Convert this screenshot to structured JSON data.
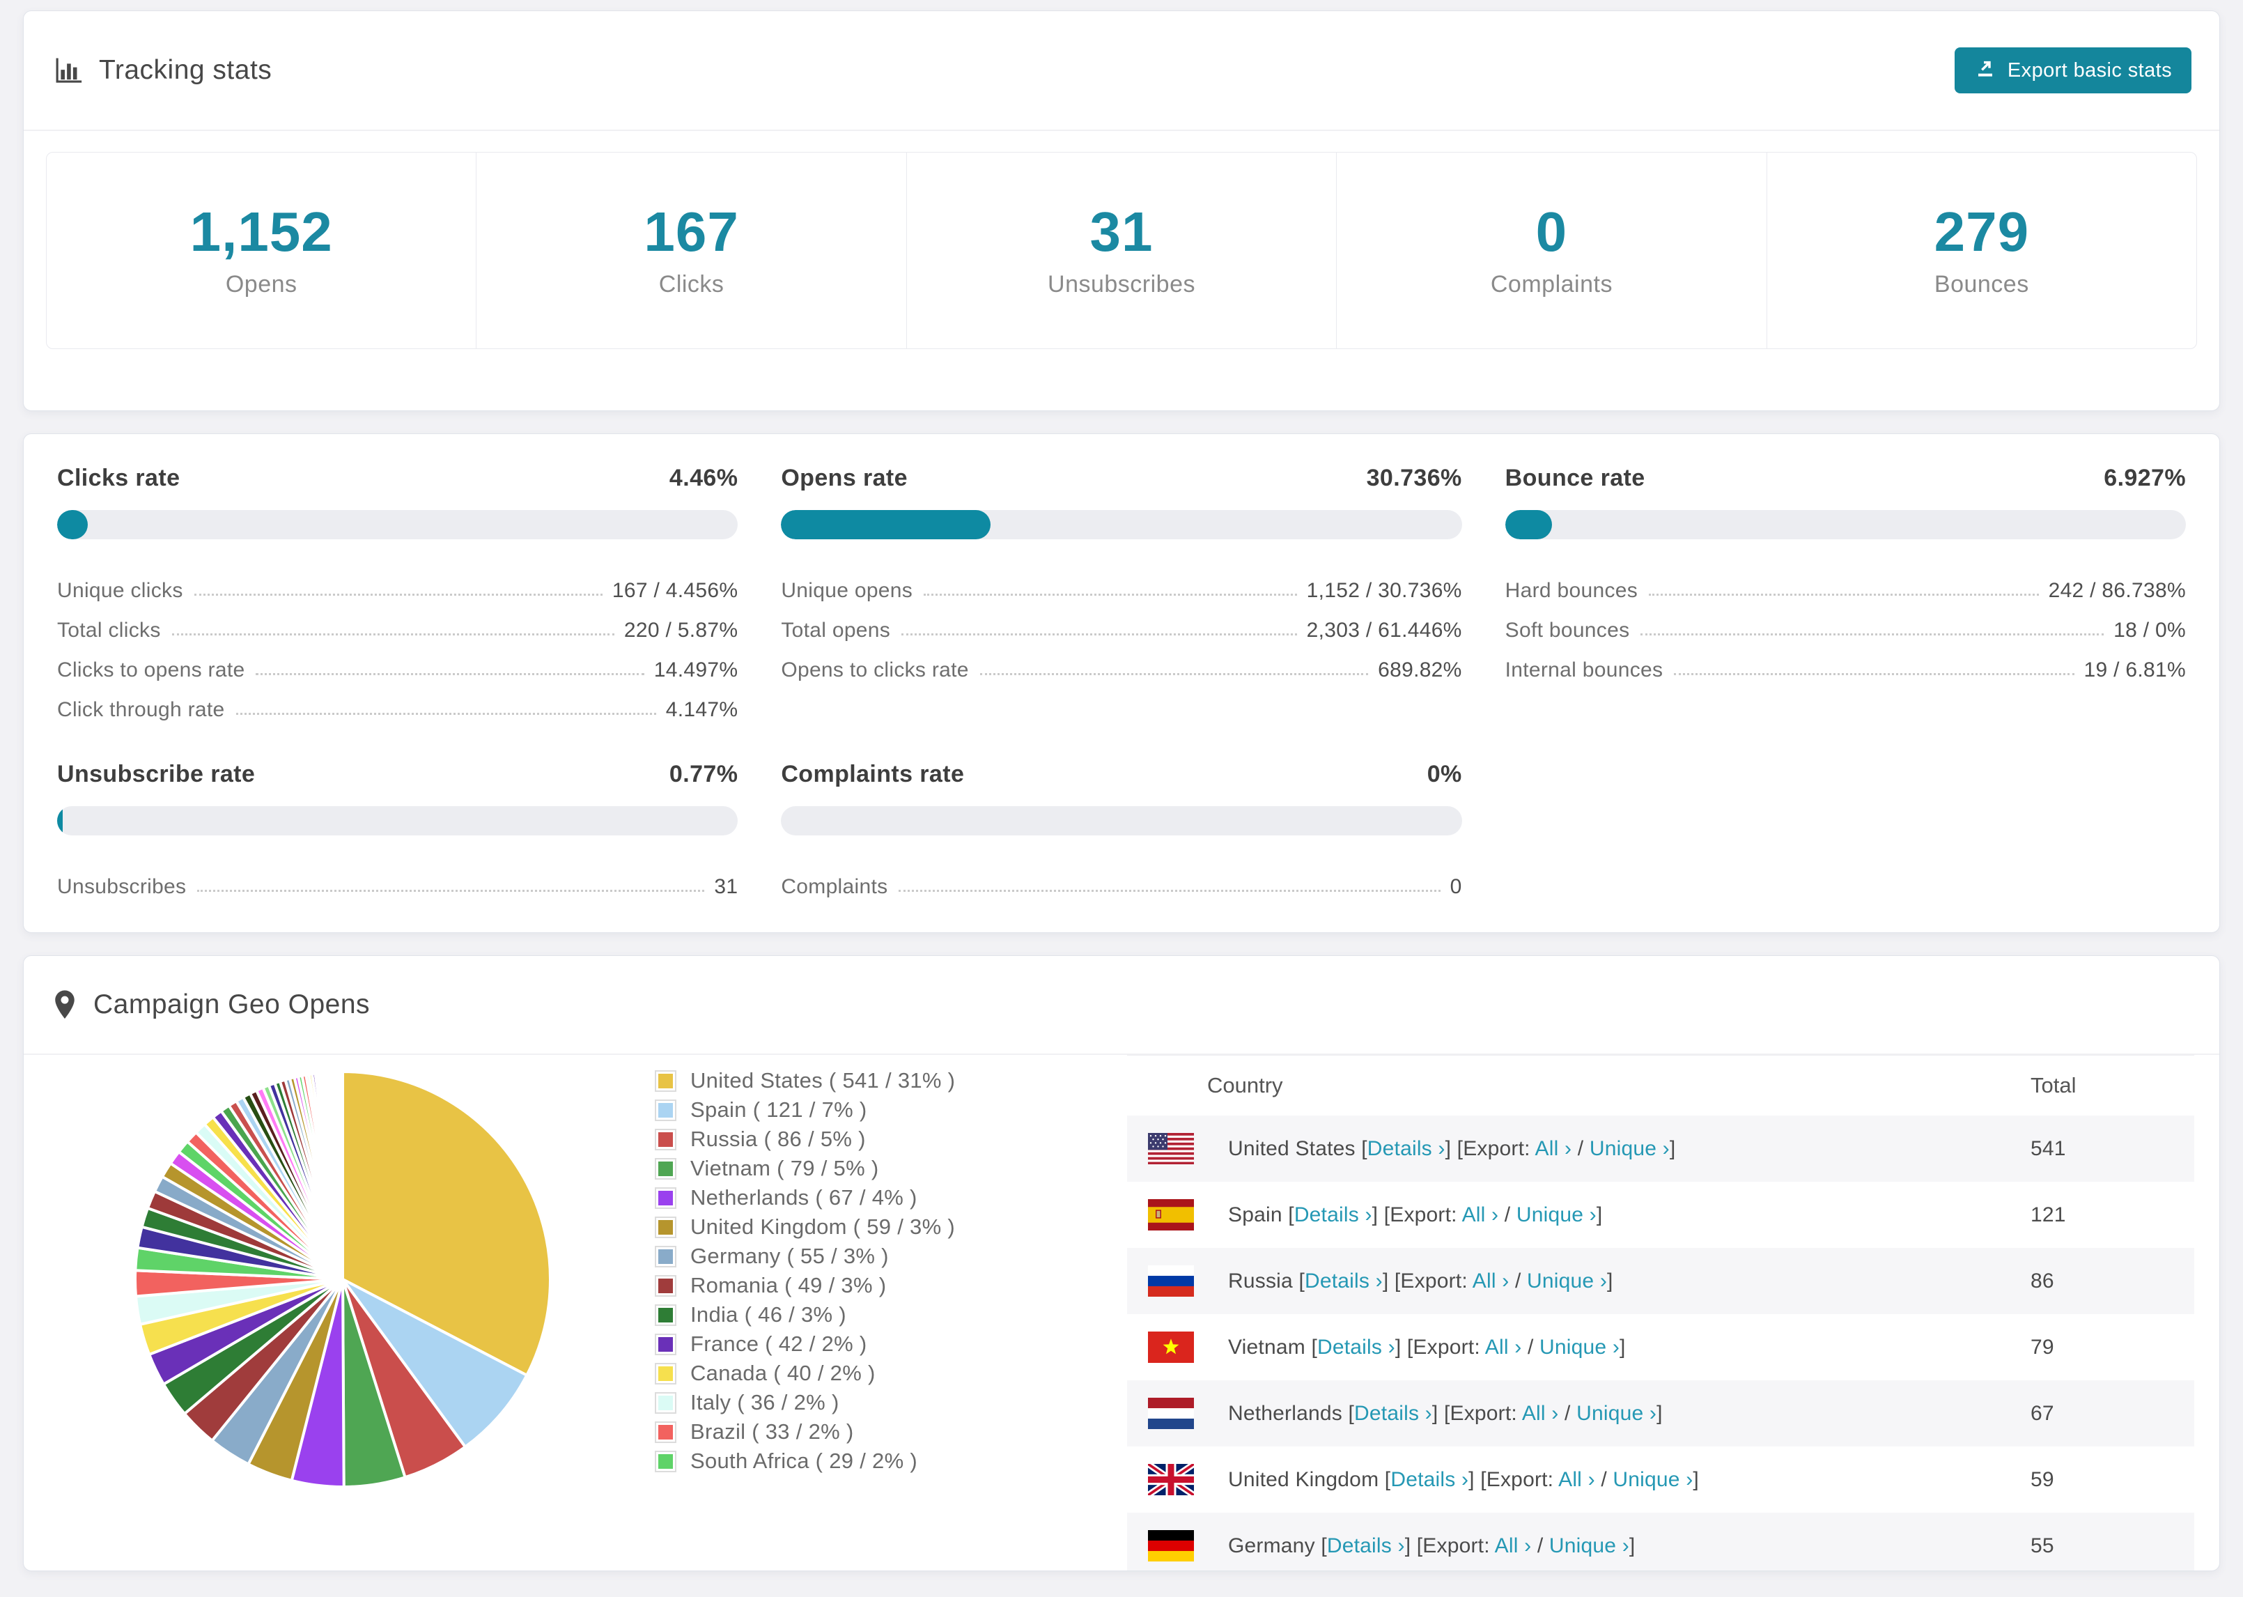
{
  "tracking": {
    "title": "Tracking stats",
    "export_button": "Export basic stats",
    "stats": [
      {
        "value": "1,152",
        "label": "Opens"
      },
      {
        "value": "167",
        "label": "Clicks"
      },
      {
        "value": "31",
        "label": "Unsubscribes"
      },
      {
        "value": "0",
        "label": "Complaints"
      },
      {
        "value": "279",
        "label": "Bounces"
      }
    ]
  },
  "rates": {
    "blocks": [
      {
        "title": "Clicks rate",
        "value": "4.46%",
        "bar_pct": 4.46,
        "rows": [
          {
            "label": "Unique clicks",
            "value": "167 / 4.456%"
          },
          {
            "label": "Total clicks",
            "value": "220 / 5.87%"
          },
          {
            "label": "Clicks to opens rate",
            "value": "14.497%"
          },
          {
            "label": "Click through rate",
            "value": "4.147%"
          }
        ]
      },
      {
        "title": "Opens rate",
        "value": "30.736%",
        "bar_pct": 30.736,
        "rows": [
          {
            "label": "Unique opens",
            "value": "1,152 / 30.736%"
          },
          {
            "label": "Total opens",
            "value": "2,303 / 61.446%"
          },
          {
            "label": "Opens to clicks rate",
            "value": "689.82%"
          }
        ]
      },
      {
        "title": "Bounce rate",
        "value": "6.927%",
        "bar_pct": 6.927,
        "rows": [
          {
            "label": "Hard bounces",
            "value": "242 / 86.738%"
          },
          {
            "label": "Soft bounces",
            "value": "18 / 0%"
          },
          {
            "label": "Internal bounces",
            "value": "19 / 6.81%"
          }
        ]
      },
      {
        "title": "Unsubscribe rate",
        "value": "0.77%",
        "bar_pct": 0.77,
        "rows": [
          {
            "label": "Unsubscribes",
            "value": "31"
          }
        ]
      },
      {
        "title": "Complaints rate",
        "value": "0%",
        "bar_pct": 0,
        "rows": [
          {
            "label": "Complaints",
            "value": "0"
          }
        ]
      }
    ]
  },
  "geo": {
    "title": "Campaign Geo Opens",
    "table": {
      "col_country": "Country",
      "col_total": "Total",
      "details": "Details",
      "export": "Export:",
      "all": "All",
      "unique": "Unique",
      "chevron": "›",
      "lb": "[",
      "rb": "]",
      "sep": "/"
    },
    "table_rows": [
      {
        "name": "United States",
        "flag": "us",
        "total": "541"
      },
      {
        "name": "Spain",
        "flag": "es",
        "total": "121"
      },
      {
        "name": "Russia",
        "flag": "ru",
        "total": "86"
      },
      {
        "name": "Vietnam",
        "flag": "vn",
        "total": "79"
      },
      {
        "name": "Netherlands",
        "flag": "nl",
        "total": "67"
      },
      {
        "name": "United Kingdom",
        "flag": "gb",
        "total": "59"
      },
      {
        "name": "Germany",
        "flag": "de",
        "total": "55"
      }
    ]
  },
  "chart_data": {
    "type": "pie",
    "title": "Campaign Geo Opens",
    "legend_position": "right",
    "start_angle_deg": -90,
    "direction": "clockwise",
    "series": [
      {
        "name": "United States",
        "value": 541,
        "pct": 31
      },
      {
        "name": "Spain",
        "value": 121,
        "pct": 7
      },
      {
        "name": "Russia",
        "value": 86,
        "pct": 5
      },
      {
        "name": "Vietnam",
        "value": 79,
        "pct": 5
      },
      {
        "name": "Netherlands",
        "value": 67,
        "pct": 4
      },
      {
        "name": "United Kingdom",
        "value": 59,
        "pct": 3
      },
      {
        "name": "Germany",
        "value": 55,
        "pct": 3
      },
      {
        "name": "Romania",
        "value": 49,
        "pct": 3
      },
      {
        "name": "India",
        "value": 46,
        "pct": 3
      },
      {
        "name": "France",
        "value": 42,
        "pct": 2
      },
      {
        "name": "Canada",
        "value": 40,
        "pct": 2
      },
      {
        "name": "Italy",
        "value": 36,
        "pct": 2
      },
      {
        "name": "Brazil",
        "value": 33,
        "pct": 2
      },
      {
        "name": "South Africa",
        "value": 29,
        "pct": 2
      }
    ],
    "colors": [
      "#e8c345",
      "#abd4f2",
      "#ca4e4c",
      "#4fa653",
      "#9a41ee",
      "#b6952d",
      "#89abc9",
      "#a03c3c",
      "#2e7d35",
      "#6a30b8",
      "#f6e04e",
      "#dbfbf5",
      "#f2625f",
      "#5fd368"
    ],
    "others_estimated": [
      27,
      25,
      23,
      21,
      20,
      18,
      17,
      16,
      15,
      14,
      13,
      12,
      11,
      10,
      10,
      9,
      9,
      8,
      8,
      7,
      7,
      6,
      6,
      5,
      5,
      5,
      4,
      4,
      4,
      3,
      3,
      3,
      3,
      2,
      2,
      2,
      2,
      2,
      2,
      1,
      1,
      1,
      1,
      1,
      1,
      1,
      1,
      1,
      1,
      1
    ],
    "others_colors": [
      "#42329e",
      "#2e7d35",
      "#9e3a3a",
      "#88aac8",
      "#b6952c",
      "#d84ff0",
      "#5ed467",
      "#f2625f",
      "#dafcf6",
      "#f7e04b",
      "#6930b8",
      "#4aa54e",
      "#c9504e",
      "#abd4f2",
      "#274e13",
      "#5b1f1f",
      "#ff7bf5",
      "#8de08a"
    ]
  }
}
